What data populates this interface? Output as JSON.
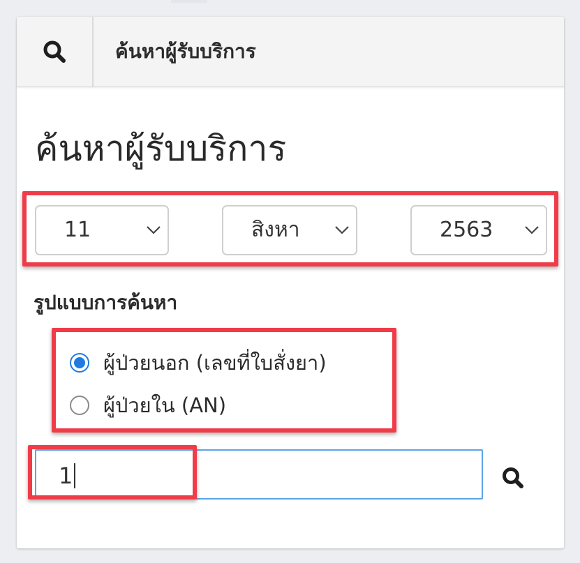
{
  "header": {
    "title": "ค้นหาผู้รับบริการ",
    "search_icon": "search-icon"
  },
  "page": {
    "title": "ค้นหาผู้รับบริการ"
  },
  "date": {
    "day": "11",
    "month": "สิงหา",
    "year": "2563"
  },
  "search_type": {
    "label": "รูปแบบการค้นหา",
    "options": [
      {
        "label": "ผู้ป่วยนอก (เลขที่ใบสั่งยา)",
        "checked": true
      },
      {
        "label": "ผู้ป่วยใน (AN)",
        "checked": false
      }
    ]
  },
  "search": {
    "value": "1",
    "button_icon": "search-icon"
  },
  "colors": {
    "accent": "#1f7ae0",
    "highlight": "#ef3c48",
    "input_focus_border": "#5aa6e8"
  }
}
